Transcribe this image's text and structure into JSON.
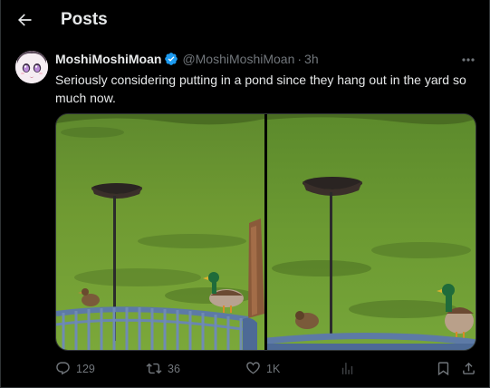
{
  "header": {
    "title": "Posts"
  },
  "post": {
    "display_name": "MoshiMoshiMoan",
    "handle": "@MoshiMoshiMoan",
    "separator": "·",
    "time": "3h",
    "text": "Seriously considering putting in a pond since they hang out in the yard so much now.",
    "photos": [
      "photo-left",
      "photo-right"
    ]
  },
  "actions": {
    "replies": "129",
    "reposts": "36",
    "likes": "1K"
  },
  "colors": {
    "background": "#000000",
    "text_primary": "#e7e9ea",
    "text_secondary": "#71767b",
    "verified": "#1d9bf0",
    "border": "#2f3336"
  },
  "icons": [
    "back-arrow-icon",
    "verified-badge-icon",
    "more-icon",
    "reply-icon",
    "repost-icon",
    "like-icon",
    "views-icon",
    "bookmark-icon",
    "share-icon"
  ]
}
